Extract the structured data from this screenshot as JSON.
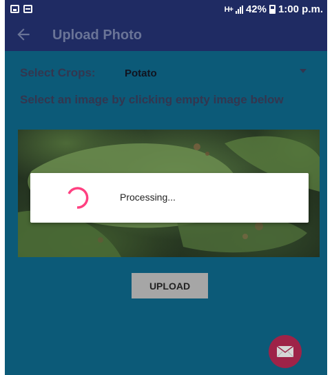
{
  "status_bar": {
    "network": "H+",
    "battery": "42%",
    "time": "1:00 p.m."
  },
  "toolbar": {
    "title": "Upload Photo"
  },
  "crop_selector": {
    "label": "Select Crops:",
    "value": "Potato"
  },
  "instruction": "Select an image by clicking empty image below",
  "upload_button": {
    "label": "UPLOAD"
  },
  "dialog": {
    "message": "Processing..."
  },
  "colors": {
    "toolbar": "#1f2b63",
    "background": "#0c5a78",
    "fab": "#9e2348",
    "spinner": "#ff4081"
  },
  "icons": [
    "image-icon",
    "message-icon",
    "signal-icon",
    "battery-icon",
    "back-arrow-icon",
    "chevron-down-icon",
    "spinner-icon",
    "mail-icon"
  ]
}
